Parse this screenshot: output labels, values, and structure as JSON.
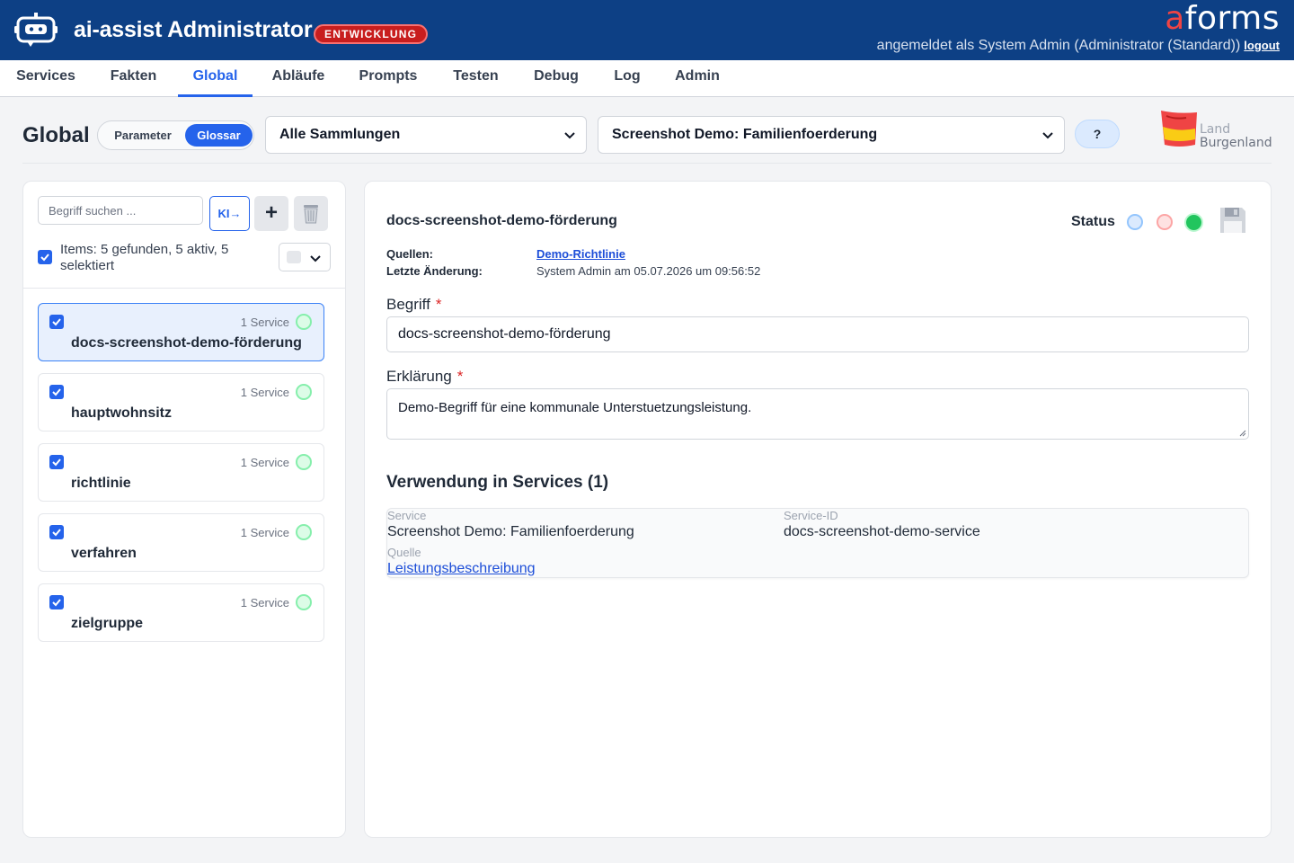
{
  "header": {
    "app_title": "ai-assist Administrator",
    "env_badge": "ENTWICKLUNG",
    "brand_prefix": "a",
    "brand_suffix": "forms",
    "logged_in_text": "angemeldet als System Admin (Administrator (Standard))",
    "logout_label": "logout",
    "bar_color": "#0d4085"
  },
  "nav": {
    "items": [
      {
        "label": "Services"
      },
      {
        "label": "Fakten"
      },
      {
        "label": "Global",
        "active": true
      },
      {
        "label": "Abläufe"
      },
      {
        "label": "Prompts"
      },
      {
        "label": "Testen"
      },
      {
        "label": "Debug"
      },
      {
        "label": "Log"
      },
      {
        "label": "Admin"
      }
    ]
  },
  "page": {
    "title": "Global",
    "toggle": {
      "param_label": "Parameter",
      "glossary_label": "Glossar",
      "active": "Glossar"
    },
    "collection_select": "Alle Sammlungen",
    "service_select": "Screenshot Demo: Familienfoerderung",
    "help_label": "?",
    "logo_line1": "Land",
    "logo_line2": "Burgenland"
  },
  "list": {
    "search_placeholder": "Begriff suchen ...",
    "ki_label": "KI→",
    "add_label": "+",
    "summary": "Items: 5 gefunden, 5 aktiv, 5 selektiert",
    "items": [
      {
        "name": "docs-screenshot-demo-förderung",
        "services": "1 Service",
        "selected": true,
        "checked": true
      },
      {
        "name": "hauptwohnsitz",
        "services": "1 Service",
        "checked": true
      },
      {
        "name": "richtlinie",
        "services": "1 Service",
        "checked": true
      },
      {
        "name": "verfahren",
        "services": "1 Service",
        "checked": true
      },
      {
        "name": "zielgruppe",
        "services": "1 Service",
        "checked": true
      }
    ]
  },
  "detail": {
    "title": "docs-screenshot-demo-förderung",
    "status_label": "Status",
    "status_colors": [
      "#bfdbfe",
      "#fecaca",
      "#22c55e"
    ],
    "active_status": "green",
    "sources_label": "Quellen:",
    "sources_value": "Demo-Richtlinie",
    "last_change_label": "Letzte Änderung:",
    "last_change_value": "System Admin am 05.07.2026 um 09:56:52",
    "term_label": "Begriff",
    "term_value": "docs-screenshot-demo-förderung",
    "explanation_label": "Erklärung",
    "explanation_value": "Demo-Begriff für eine kommunale Unterstuetzungsleistung.",
    "required_mark": "*",
    "usage_title": "Verwendung in Services (1)",
    "usage": {
      "service_label": "Service",
      "service_value": "Screenshot Demo: Familienfoerderung",
      "service_id_label": "Service-ID",
      "service_id_value": "docs-screenshot-demo-service",
      "source_label": "Quelle",
      "source_value": "Leistungsbeschreibung"
    }
  }
}
